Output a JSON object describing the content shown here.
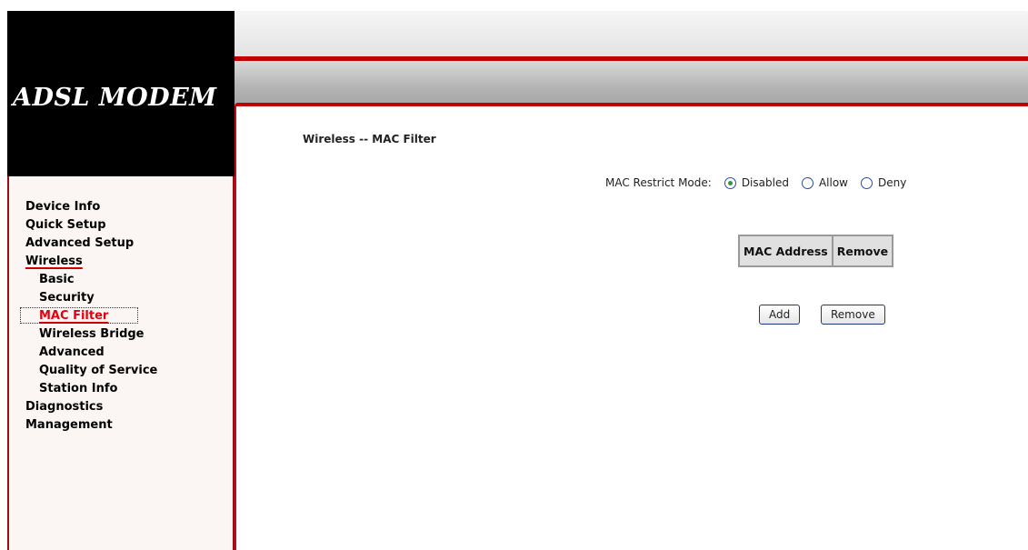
{
  "brand": {
    "title": "ADSL MODEM"
  },
  "menu": {
    "items": [
      {
        "label": "Device Info",
        "level": 0
      },
      {
        "label": "Quick Setup",
        "level": 0
      },
      {
        "label": "Advanced Setup",
        "level": 0
      },
      {
        "label": "Wireless",
        "level": 0
      },
      {
        "label": "Basic",
        "level": 1
      },
      {
        "label": "Security",
        "level": 1
      },
      {
        "label": "MAC Filter",
        "level": 1
      },
      {
        "label": "Wireless Bridge",
        "level": 1
      },
      {
        "label": "Advanced",
        "level": 1
      },
      {
        "label": "Quality of Service",
        "level": 1
      },
      {
        "label": "Station Info",
        "level": 1
      },
      {
        "label": "Diagnostics",
        "level": 0
      },
      {
        "label": "Management",
        "level": 0
      }
    ],
    "active": "MAC Filter"
  },
  "page": {
    "title": "Wireless -- MAC Filter"
  },
  "mode": {
    "label": "MAC Restrict Mode:",
    "options": [
      "Disabled",
      "Allow",
      "Deny"
    ],
    "selected": "Disabled"
  },
  "table": {
    "headers": [
      "MAC Address",
      "Remove"
    ]
  },
  "buttons": {
    "add": "Add",
    "remove": "Remove"
  },
  "colors": {
    "accent_red": "#c00000",
    "active_text": "#e3000f"
  }
}
